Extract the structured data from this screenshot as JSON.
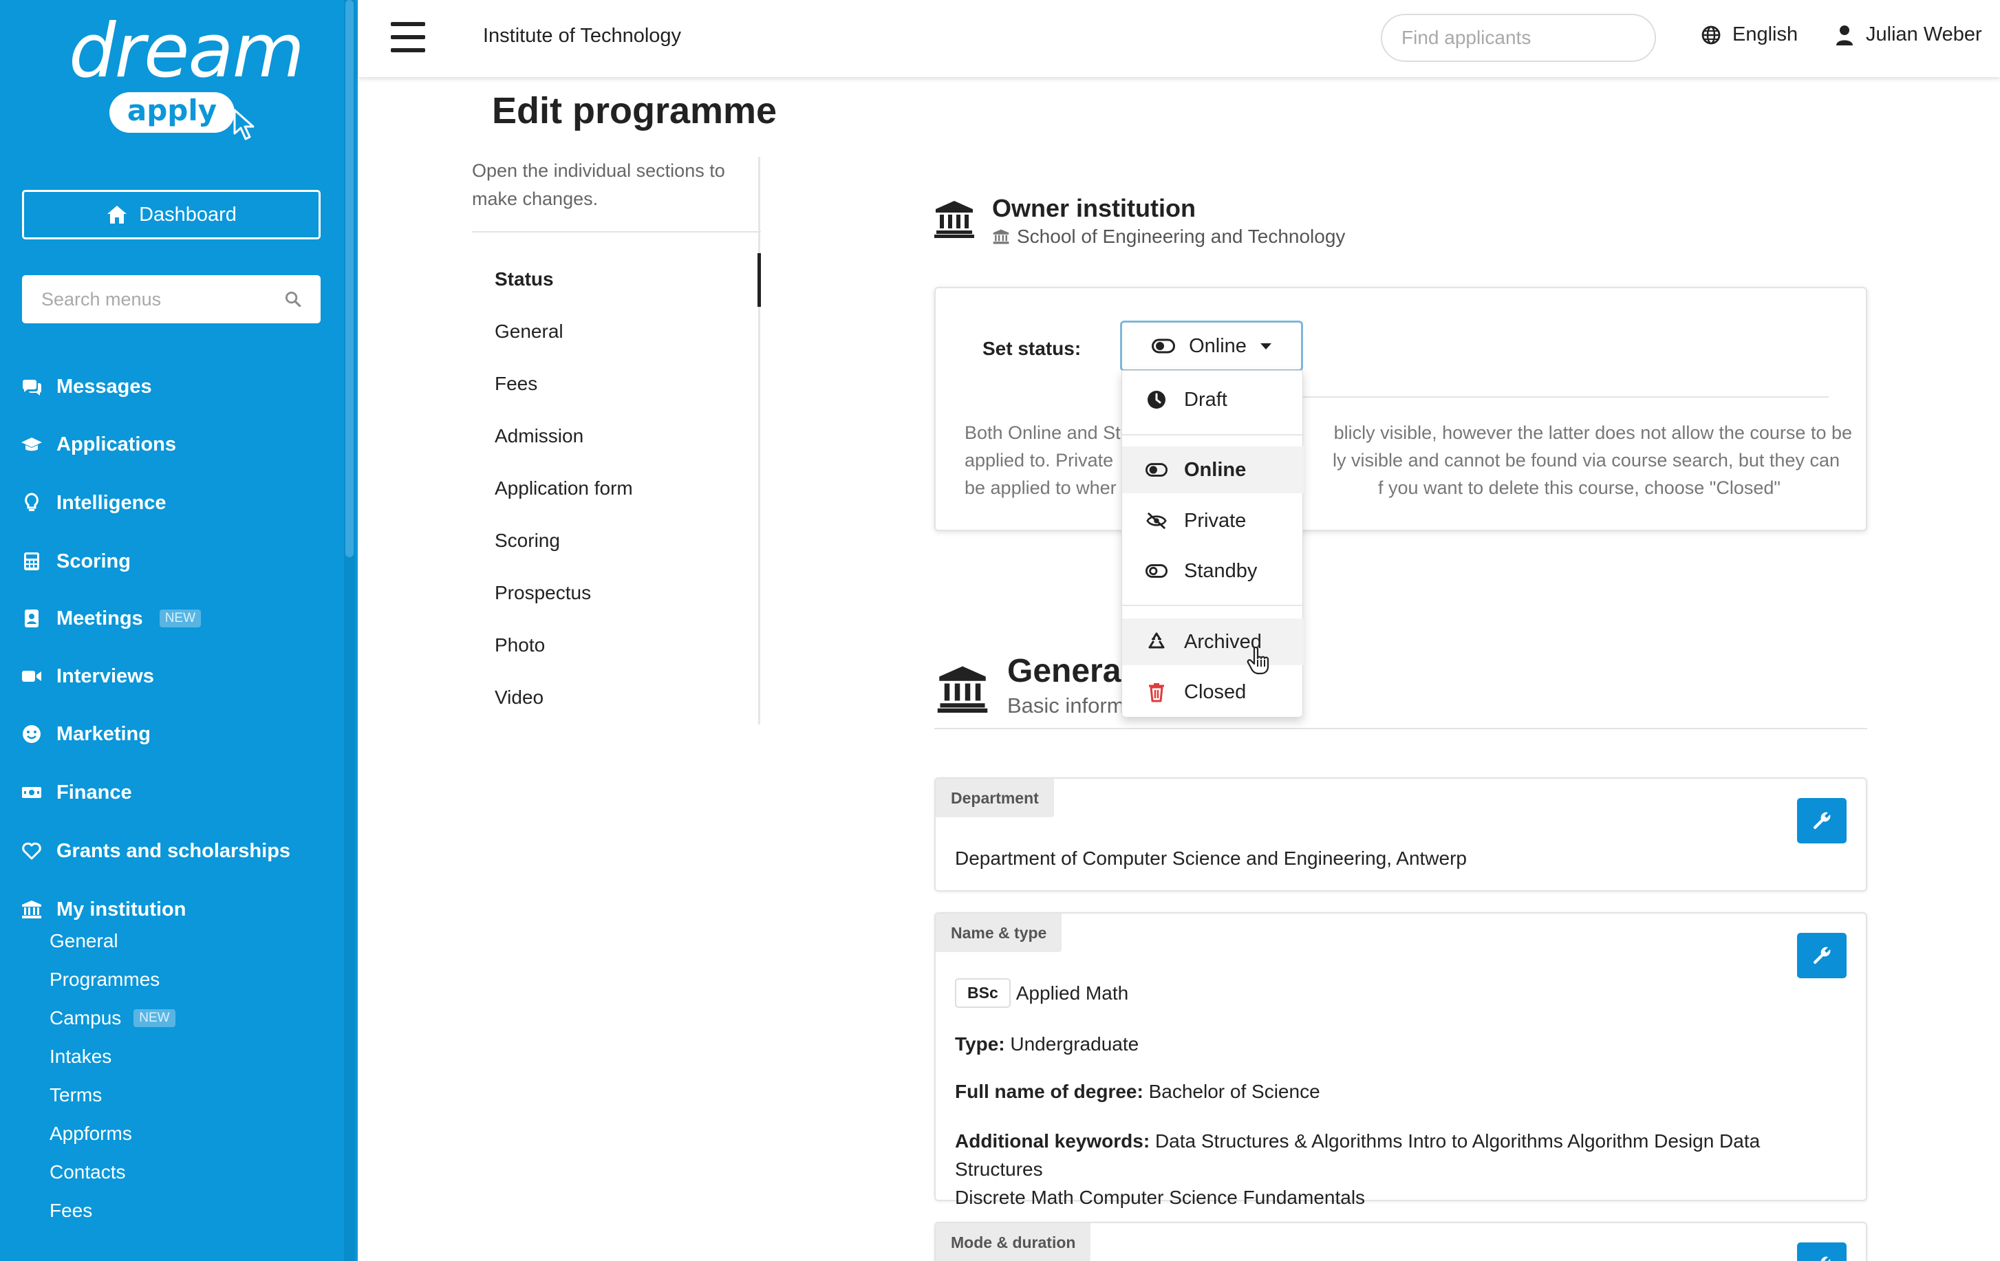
{
  "sidebar": {
    "logo_text": "dream",
    "logo_badge": "apply",
    "dashboard_label": "Dashboard",
    "search_placeholder": "Search menus",
    "nav": [
      {
        "label": "Messages",
        "icon": "messages-icon"
      },
      {
        "label": "Applications",
        "icon": "graduation-cap-icon"
      },
      {
        "label": "Intelligence",
        "icon": "lightbulb-icon"
      },
      {
        "label": "Scoring",
        "icon": "calculator-icon"
      },
      {
        "label": "Meetings",
        "icon": "contact-book-icon",
        "badge": "NEW"
      },
      {
        "label": "Interviews",
        "icon": "video-camera-icon"
      },
      {
        "label": "Marketing",
        "icon": "smiley-icon"
      },
      {
        "label": "Finance",
        "icon": "money-icon"
      },
      {
        "label": "Grants and scholarships",
        "icon": "heart-icon"
      },
      {
        "label": "My institution",
        "icon": "institution-icon"
      }
    ],
    "sub_items": [
      {
        "label": "General"
      },
      {
        "label": "Programmes"
      },
      {
        "label": "Campus",
        "badge": "NEW"
      },
      {
        "label": "Intakes"
      },
      {
        "label": "Terms"
      },
      {
        "label": "Appforms"
      },
      {
        "label": "Contacts"
      },
      {
        "label": "Fees"
      }
    ]
  },
  "header": {
    "institution": "Institute of Technology",
    "search_placeholder": "Find applicants",
    "language": "English",
    "user_name": "Julian Weber"
  },
  "page": {
    "title": "Edit programme",
    "intro": "Open the individual sections to make changes.",
    "sections": [
      "Status",
      "General",
      "Fees",
      "Admission",
      "Application form",
      "Scoring",
      "Prospectus",
      "Photo",
      "Video"
    ],
    "active_section": "Status"
  },
  "owner": {
    "title": "Owner institution",
    "institution": "School of Engineering and Technology"
  },
  "status": {
    "label": "Set status:",
    "current": "Online",
    "help_before": "Both Online and St",
    "help_line1_end": "blicly visible, however the latter does not allow the course to be",
    "help_line2_start": "applied to. Private",
    "help_line2_end": "ly visible and cannot be found via course search, but they can",
    "help_line3_start": "be applied to wher",
    "help_line3_end": "f you want to delete this course, choose \"Closed\"",
    "options": [
      {
        "label": "Draft",
        "icon": "clock-icon"
      },
      {
        "label": "Online",
        "icon": "toggle-on-icon"
      },
      {
        "label": "Private",
        "icon": "eye-slash-icon"
      },
      {
        "label": "Standby",
        "icon": "toggle-off-icon"
      },
      {
        "label": "Archived",
        "icon": "recycle-icon"
      },
      {
        "label": "Closed",
        "icon": "trash-icon",
        "color": "#e03b3b"
      }
    ],
    "hovered": "Archived"
  },
  "general": {
    "title": "General",
    "subtitle": "Basic inform",
    "department_tag": "Department",
    "department": "Department of Computer Science and Engineering, Antwerp",
    "name_tag": "Name & type",
    "degree_abbr": "BSc",
    "programme_name": "Applied Math",
    "type_label": "Type:",
    "type_value": "Undergraduate",
    "degree_label": "Full name of degree:",
    "degree_value": "Bachelor of Science",
    "keywords_label": "Additional keywords:",
    "keywords_line1": "Data Structures & Algorithms Intro to Algorithms Algorithm Design Data Structures",
    "keywords_line2": "Discrete Math Computer Science Fundamentals",
    "mode_tag": "Mode & duration"
  },
  "colors": {
    "sidebar": "#0b97d9",
    "accent": "#0b8fd6",
    "danger": "#e03b3b"
  }
}
